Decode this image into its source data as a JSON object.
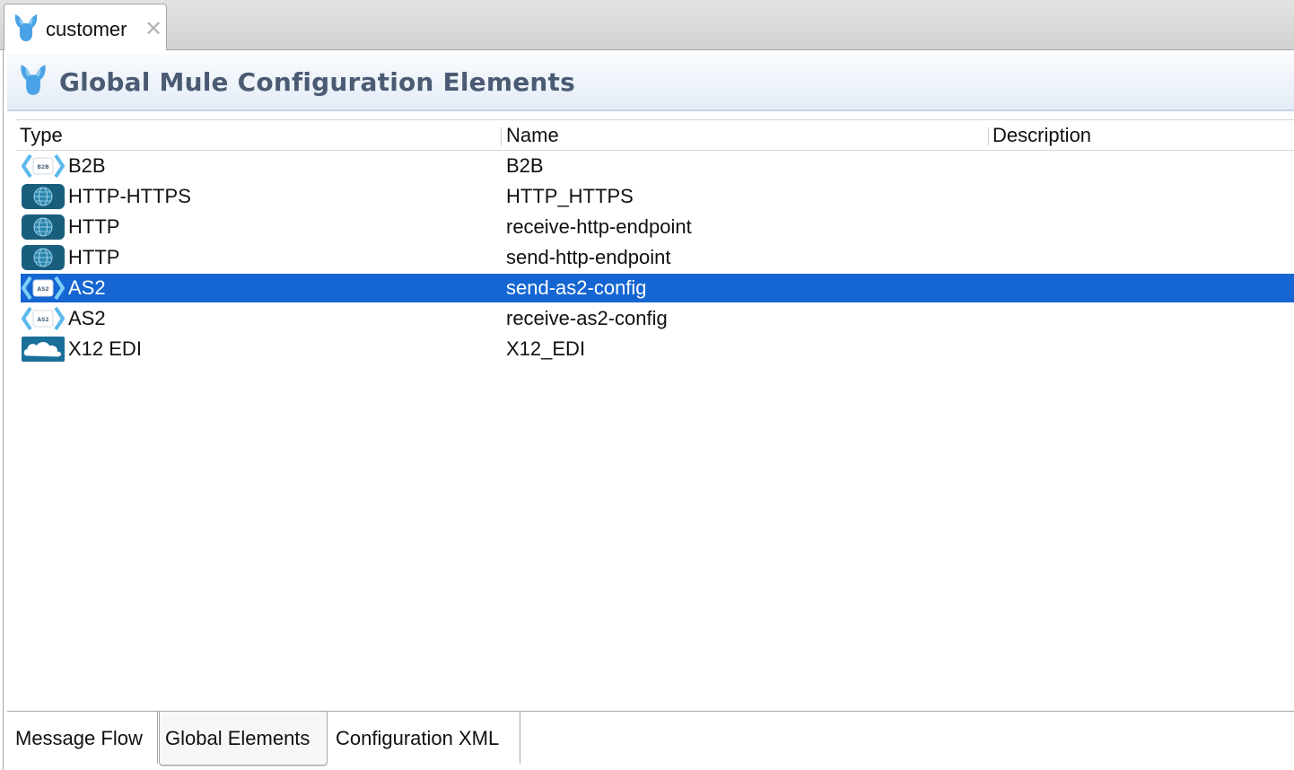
{
  "editor_tab": {
    "label": "customer",
    "icon": "mule-icon",
    "close_icon": "close-icon"
  },
  "section": {
    "title": "Global Mule Configuration Elements",
    "icon": "mule-icon"
  },
  "table": {
    "columns": [
      "Type",
      "Name",
      "Description"
    ],
    "rows": [
      {
        "type": "B2B",
        "name": "B2B",
        "description": "",
        "icon": "b2b-icon"
      },
      {
        "type": "HTTP-HTTPS",
        "name": "HTTP_HTTPS",
        "description": "",
        "icon": "globe-icon"
      },
      {
        "type": "HTTP",
        "name": "receive-http-endpoint",
        "description": "",
        "icon": "globe-icon"
      },
      {
        "type": "HTTP",
        "name": "send-http-endpoint",
        "description": "",
        "icon": "globe-icon"
      },
      {
        "type": "AS2",
        "name": "send-as2-config",
        "description": "",
        "icon": "as2-icon",
        "selected": true
      },
      {
        "type": "AS2",
        "name": "receive-as2-config",
        "description": "",
        "icon": "as2-icon"
      },
      {
        "type": "X12 EDI",
        "name": "X12_EDI",
        "description": "",
        "icon": "cloud-icon"
      }
    ]
  },
  "bottom_tabs": [
    {
      "label": "Message Flow"
    },
    {
      "label": "Global Elements",
      "active": true
    },
    {
      "label": "Configuration XML"
    }
  ],
  "colors": {
    "selection": "#1565d2",
    "header_title": "#4a5b73",
    "mule_blue": "#4aa3e6",
    "globe_dark": "#1a5e7e"
  }
}
